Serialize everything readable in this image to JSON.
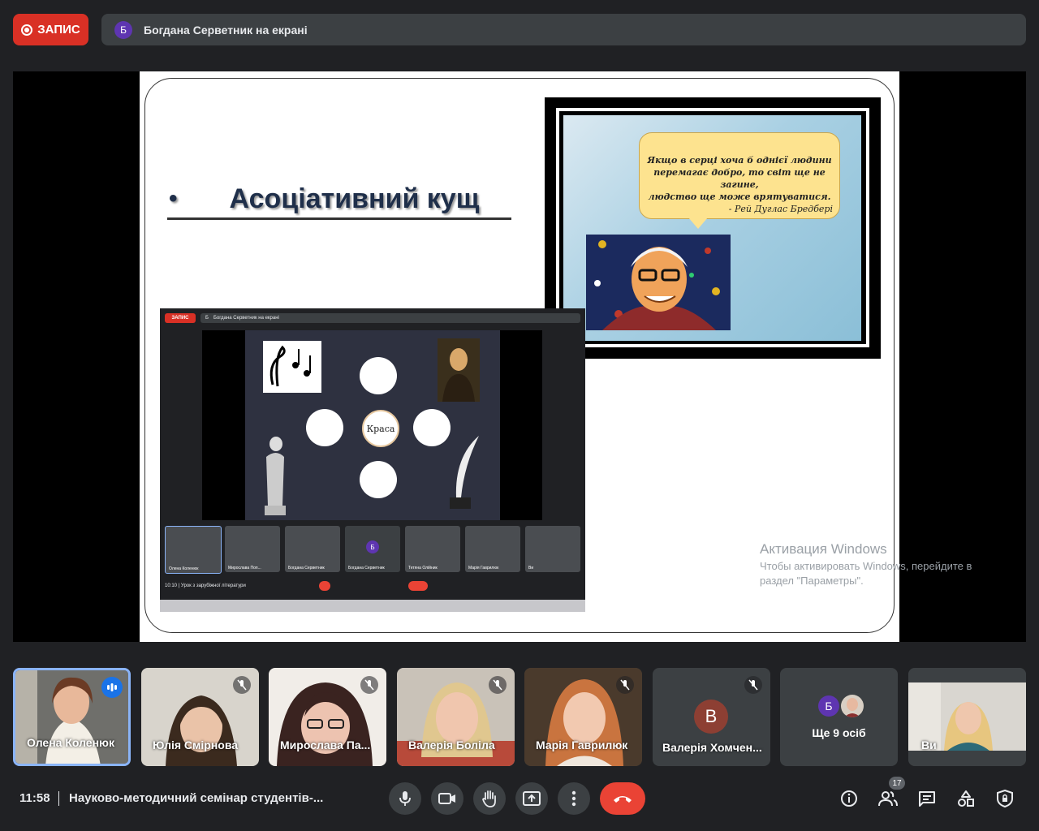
{
  "topbar": {
    "record_label": "ЗАПИС",
    "presenter_initial": "Б",
    "presenter_text": "Богдана Серветник на екрані"
  },
  "slide": {
    "bullet": "•",
    "title": "Асоціативний кущ",
    "quote_lines": [
      "Якщо в серці хоча б однієї людини",
      "перемагає добро, то світ ще не загине,",
      "людство ще може врятуватися."
    ],
    "quote_author": "- Рей Дуглас Бредбері",
    "nested": {
      "record_label": "ЗАПИС",
      "presenter_initial": "Б",
      "presenter_text": "Богдана Серветник на екрані",
      "center_word": "Краса",
      "tiles": [
        "Олена Коленюк",
        "Мирослава Поп...",
        "Богдана Серветник",
        "Богдана Серветник",
        "Тетяна Олійник",
        "Марія Гаврилюк",
        "Ви"
      ],
      "tile_initial": "Б",
      "meeting": "10:10  |  Урок з зарубіжної літератури"
    }
  },
  "watermark": {
    "title": "Активация Windows",
    "subtitle": "Чтобы активировать Windows, перейдите в раздел \"Параметры\"."
  },
  "participants": [
    {
      "name": "Олена Коленюк",
      "speaking": true
    },
    {
      "name": "Юлія Смірнова",
      "muted": true
    },
    {
      "name": "Мирослава Па...",
      "muted": true
    },
    {
      "name": "Валерія Боліла",
      "muted": true
    },
    {
      "name": "Марія Гаврилюк",
      "muted": true
    },
    {
      "name": "Валерія Хомчен...",
      "initial": "В",
      "muted": true
    },
    {
      "name": "Ще 9 осіб",
      "initial": "Б"
    },
    {
      "name": "Ви"
    }
  ],
  "bottombar": {
    "time": "11:58",
    "meeting_title": "Науково-методичний семінар студентів-...",
    "people_count": "17"
  }
}
